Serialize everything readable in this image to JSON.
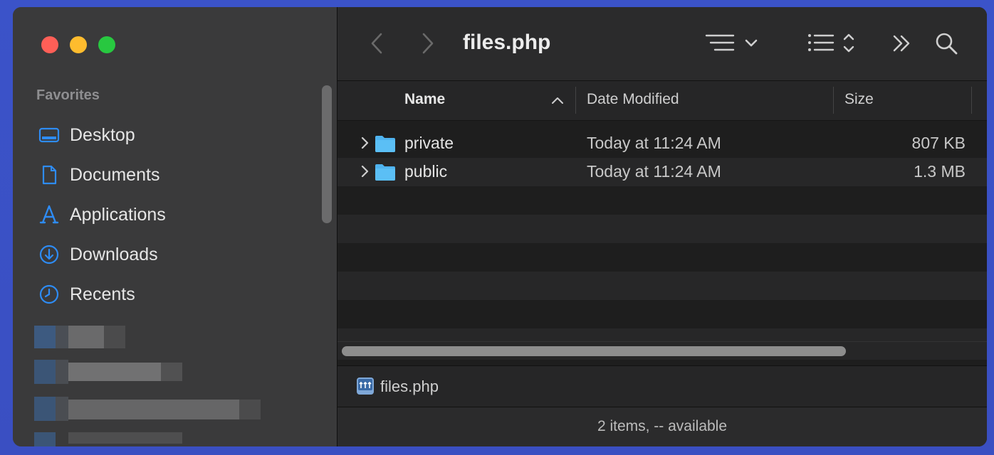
{
  "window": {
    "title": "files.php"
  },
  "sidebar": {
    "section_title": "Favorites",
    "items": [
      {
        "label": "Desktop",
        "icon": "desktop-icon"
      },
      {
        "label": "Documents",
        "icon": "document-icon"
      },
      {
        "label": "Applications",
        "icon": "applications-icon"
      },
      {
        "label": "Downloads",
        "icon": "downloads-icon"
      },
      {
        "label": "Recents",
        "icon": "clock-icon"
      }
    ],
    "accent_color": "#2e8cf5"
  },
  "columns": {
    "name": "Name",
    "date": "Date Modified",
    "size": "Size"
  },
  "files": [
    {
      "name": "private",
      "date": "Today at 11:24 AM",
      "size": "807 KB"
    },
    {
      "name": "public",
      "date": "Today at 11:24 AM",
      "size": "1.3 MB"
    }
  ],
  "pathbar": {
    "label": "files.php"
  },
  "status": {
    "text": "2 items, -- available"
  },
  "colors": {
    "folder": "#4fb3ef",
    "traffic_red": "#fe5f57",
    "traffic_yellow": "#febc2e",
    "traffic_green": "#28c840"
  }
}
